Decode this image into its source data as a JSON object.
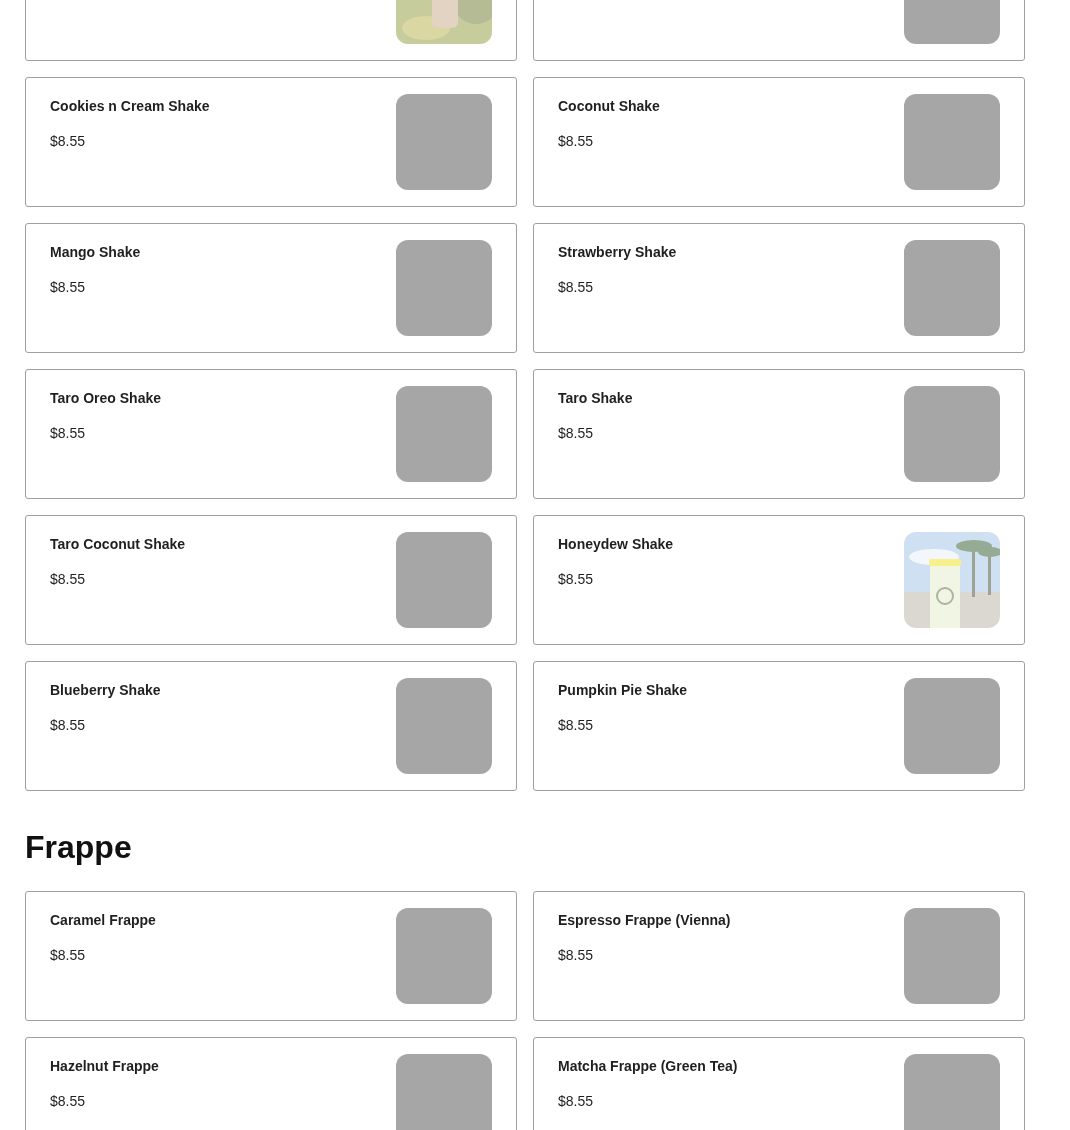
{
  "sections": [
    {
      "items": [
        {
          "image": {
            "kind": "picture"
          }
        },
        {
          "image": {
            "kind": "placeholder"
          }
        },
        {
          "name": "Cookies n Cream Shake",
          "price": "$8.55",
          "image": {
            "kind": "placeholder"
          }
        },
        {
          "name": "Coconut Shake",
          "price": "$8.55",
          "image": {
            "kind": "placeholder"
          }
        },
        {
          "name": "Mango Shake",
          "price": "$8.55",
          "image": {
            "kind": "placeholder"
          }
        },
        {
          "name": "Strawberry Shake",
          "price": "$8.55",
          "image": {
            "kind": "placeholder"
          }
        },
        {
          "name": "Taro Oreo Shake",
          "price": "$8.55",
          "image": {
            "kind": "placeholder"
          }
        },
        {
          "name": "Taro Shake",
          "price": "$8.55",
          "image": {
            "kind": "placeholder"
          }
        },
        {
          "name": "Taro Coconut Shake",
          "price": "$8.55",
          "image": {
            "kind": "placeholder"
          }
        },
        {
          "name": "Honeydew Shake",
          "price": "$8.55",
          "image": {
            "kind": "picture"
          }
        },
        {
          "name": "Blueberry Shake",
          "price": "$8.55",
          "image": {
            "kind": "placeholder"
          }
        },
        {
          "name": "Pumpkin Pie Shake",
          "price": "$8.55",
          "image": {
            "kind": "placeholder"
          }
        }
      ]
    },
    {
      "title": "Frappe",
      "items": [
        {
          "name": "Caramel Frappe",
          "price": "$8.55",
          "image": {
            "kind": "placeholder"
          }
        },
        {
          "name": "Espresso Frappe (Vienna)",
          "price": "$8.55",
          "image": {
            "kind": "placeholder"
          }
        },
        {
          "name": "Hazelnut Frappe",
          "price": "$8.55",
          "image": {
            "kind": "placeholder"
          }
        },
        {
          "name": "Matcha Frappe (Green Tea)",
          "price": "$8.55",
          "image": {
            "kind": "placeholder"
          }
        }
      ]
    }
  ]
}
